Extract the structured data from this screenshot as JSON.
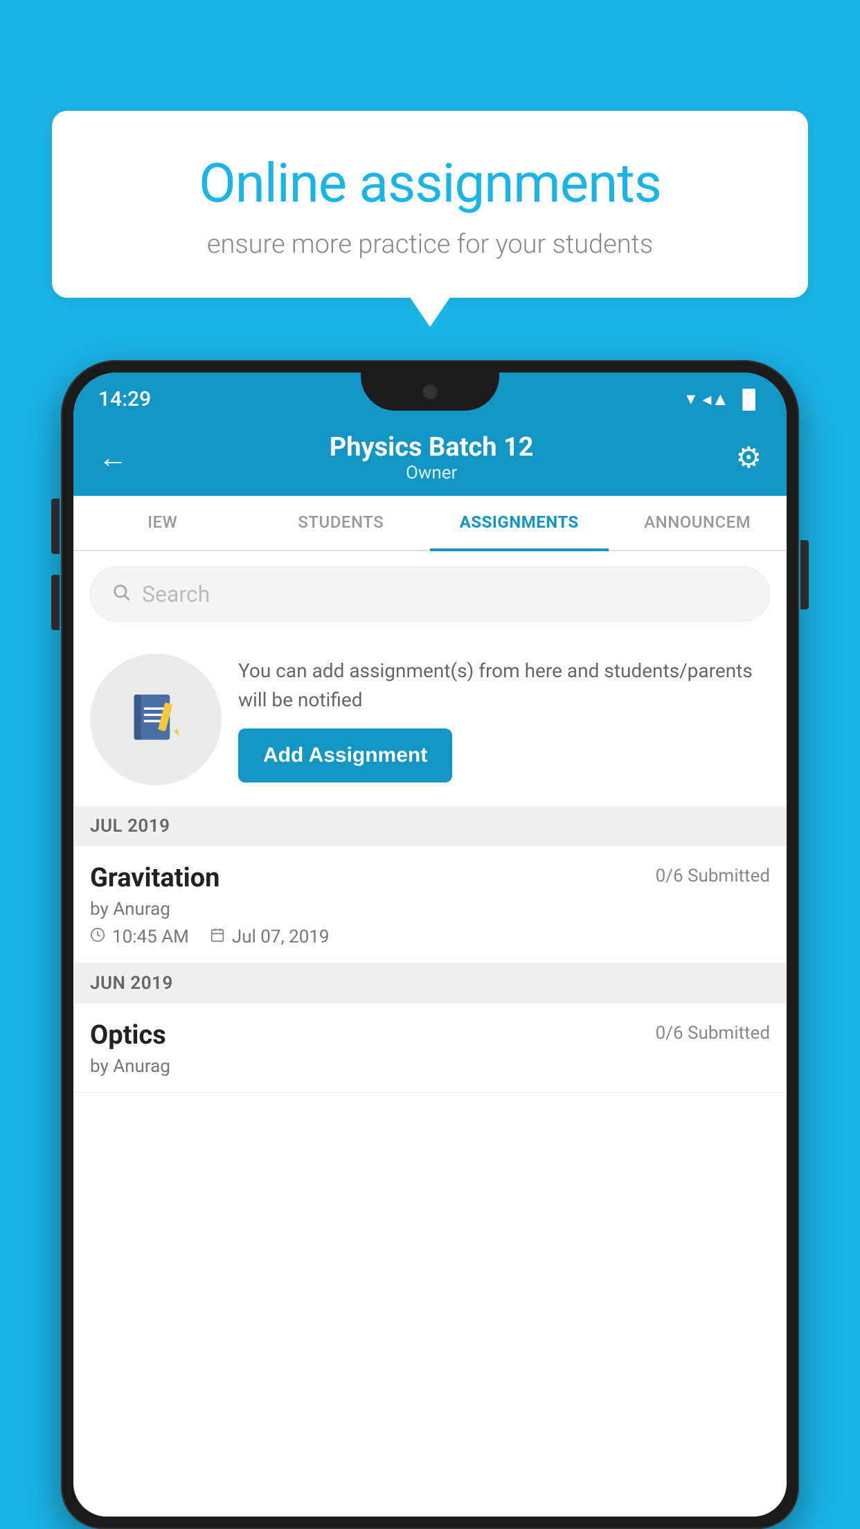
{
  "background_color": "#1ab5e8",
  "bubble": {
    "title": "Online assignments",
    "subtitle": "ensure more practice for your students"
  },
  "status_bar": {
    "time": "14:29",
    "wifi": "▼",
    "signal": "▲",
    "battery": "▐"
  },
  "header": {
    "title": "Physics Batch 12",
    "subtitle": "Owner",
    "back_label": "←",
    "settings_label": "⚙"
  },
  "tabs": [
    {
      "label": "IEW",
      "active": false
    },
    {
      "label": "STUDENTS",
      "active": false
    },
    {
      "label": "ASSIGNMENTS",
      "active": true
    },
    {
      "label": "ANNOUNCEM",
      "active": false
    }
  ],
  "search": {
    "placeholder": "Search"
  },
  "promo": {
    "text": "You can add assignment(s) from here and students/parents will be notified",
    "button_label": "Add Assignment"
  },
  "sections": [
    {
      "label": "JUL 2019",
      "assignments": [
        {
          "title": "Gravitation",
          "submitted": "0/6 Submitted",
          "by": "by Anurag",
          "time": "10:45 AM",
          "date": "Jul 07, 2019"
        }
      ]
    },
    {
      "label": "JUN 2019",
      "assignments": [
        {
          "title": "Optics",
          "submitted": "0/6 Submitted",
          "by": "by Anurag",
          "time": "",
          "date": ""
        }
      ]
    }
  ]
}
